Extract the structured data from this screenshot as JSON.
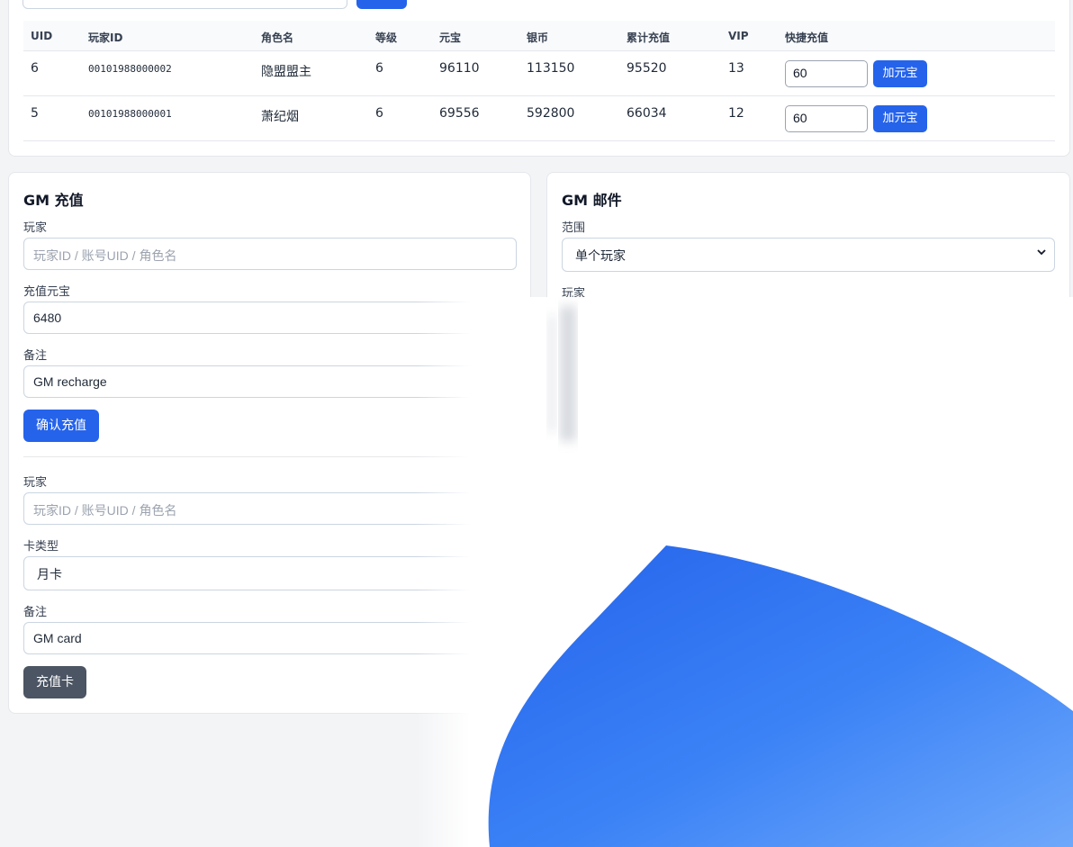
{
  "table": {
    "headers": [
      "UID",
      "玩家ID",
      "角色名",
      "等级",
      "元宝",
      "银币",
      "累计充值",
      "VIP",
      "快捷充值"
    ],
    "rows": [
      {
        "uid": "6",
        "player_id": "00101988000002",
        "role": "隐盟盟主",
        "level": "6",
        "yuanbao": "96110",
        "silver": "113150",
        "total_recharge": "95520",
        "vip": "13",
        "quick_value": "60",
        "quick_btn": "加元宝"
      },
      {
        "uid": "5",
        "player_id": "00101988000001",
        "role": "萧纪烟",
        "level": "6",
        "yuanbao": "69556",
        "silver": "592800",
        "total_recharge": "66034",
        "vip": "12",
        "quick_value": "60",
        "quick_btn": "加元宝"
      }
    ]
  },
  "gm_recharge": {
    "title": "GM 充值",
    "player_label": "玩家",
    "player_placeholder": "玩家ID / 账号UID / 角色名",
    "amount_label": "充值元宝",
    "amount_value": "6480",
    "note_label": "备注",
    "note_value": "GM recharge",
    "confirm_label": "确认充值",
    "card_player_label": "玩家",
    "card_player_placeholder": "玩家ID / 账号UID / 角色名",
    "card_type_label": "卡类型",
    "card_type_value": "月卡",
    "card_note_label": "备注",
    "card_note_value": "GM card",
    "card_button_label": "充值卡"
  },
  "gm_mail": {
    "title": "GM 邮件",
    "scope_label": "范围",
    "scope_value": "单个玩家",
    "player_label": "玩家"
  },
  "colors": {
    "primary": "#2563eb",
    "dark_button": "#4b5563",
    "page_bg": "#f3f4f6"
  }
}
